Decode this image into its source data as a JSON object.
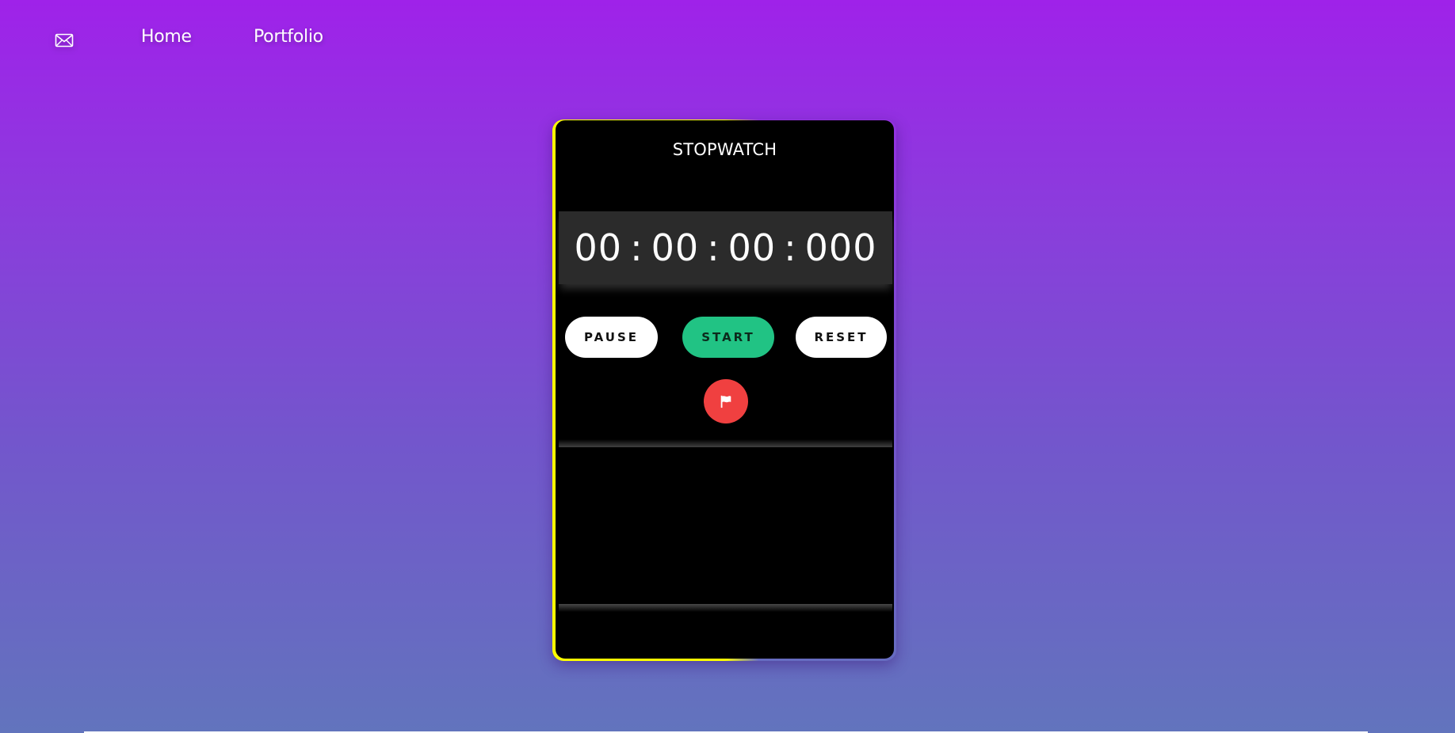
{
  "nav": {
    "mail_icon": "envelope-icon",
    "home_label": "Home",
    "portfolio_label": "Portfolio"
  },
  "stopwatch": {
    "title": "STOPWATCH",
    "time": {
      "hours": "00",
      "minutes": "00",
      "seconds": "00",
      "milliseconds": "000",
      "separator": ":"
    },
    "buttons": {
      "pause_label": "PAUSE",
      "start_label": "START",
      "reset_label": "RESET",
      "lap_icon": "flag-icon"
    },
    "laps": []
  },
  "colors": {
    "background_top": "#9f22e9",
    "background_bottom": "#6274bd",
    "card": "#000000",
    "display": "#2b2b2b",
    "start_button": "#21c384",
    "lap_button": "#f04040",
    "border_accent": "#ffff00"
  }
}
